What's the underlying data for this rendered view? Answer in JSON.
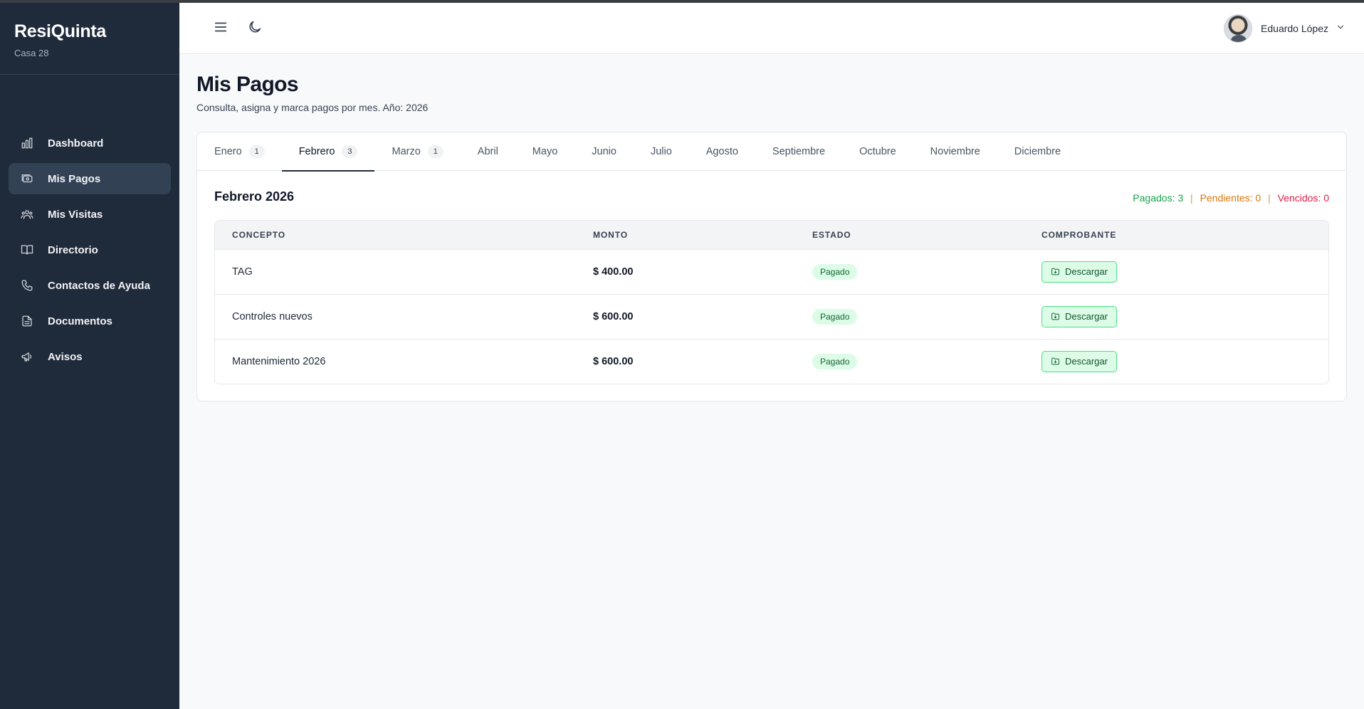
{
  "sidebar": {
    "brand": "ResiQuinta",
    "subtitle": "Casa 28",
    "items": [
      {
        "label": "Dashboard",
        "icon": "chart-icon"
      },
      {
        "label": "Mis Pagos",
        "icon": "payments-icon",
        "active": true
      },
      {
        "label": "Mis Visitas",
        "icon": "users-icon"
      },
      {
        "label": "Directorio",
        "icon": "book-icon"
      },
      {
        "label": "Contactos de Ayuda",
        "icon": "phone-icon"
      },
      {
        "label": "Documentos",
        "icon": "document-icon"
      },
      {
        "label": "Avisos",
        "icon": "megaphone-icon"
      }
    ]
  },
  "header": {
    "menu_icon": "menu-icon",
    "theme_icon": "moon-icon",
    "user_name": "Eduardo López"
  },
  "page": {
    "title": "Mis Pagos",
    "subtitle": "Consulta, asigna y marca pagos por mes. Año: 2026"
  },
  "tabs": [
    {
      "label": "Enero",
      "count": "1"
    },
    {
      "label": "Febrero",
      "count": "3",
      "active": true
    },
    {
      "label": "Marzo",
      "count": "1"
    },
    {
      "label": "Abril"
    },
    {
      "label": "Mayo"
    },
    {
      "label": "Junio"
    },
    {
      "label": "Julio"
    },
    {
      "label": "Agosto"
    },
    {
      "label": "Septiembre"
    },
    {
      "label": "Octubre"
    },
    {
      "label": "Noviembre"
    },
    {
      "label": "Diciembre"
    }
  ],
  "section": {
    "title": "Febrero 2026",
    "summary": {
      "paid": "Pagados: 3",
      "pending": "Pendientes: 0",
      "overdue": "Vencidos: 0",
      "separator": "|"
    }
  },
  "table": {
    "headers": [
      "CONCEPTO",
      "MONTO",
      "ESTADO",
      "COMPROBANTE"
    ],
    "rows": [
      {
        "concept": "TAG",
        "amount": "$ 400.00",
        "status": "Pagado",
        "action": "Descargar"
      },
      {
        "concept": "Controles nuevos",
        "amount": "$ 600.00",
        "status": "Pagado",
        "action": "Descargar"
      },
      {
        "concept": "Mantenimiento 2026",
        "amount": "$ 600.00",
        "status": "Pagado",
        "action": "Descargar"
      }
    ]
  },
  "colors": {
    "sidebar_bg": "#1f2a3b",
    "paid": "#16a34a",
    "pending": "#d97706",
    "overdue": "#e11d48"
  }
}
